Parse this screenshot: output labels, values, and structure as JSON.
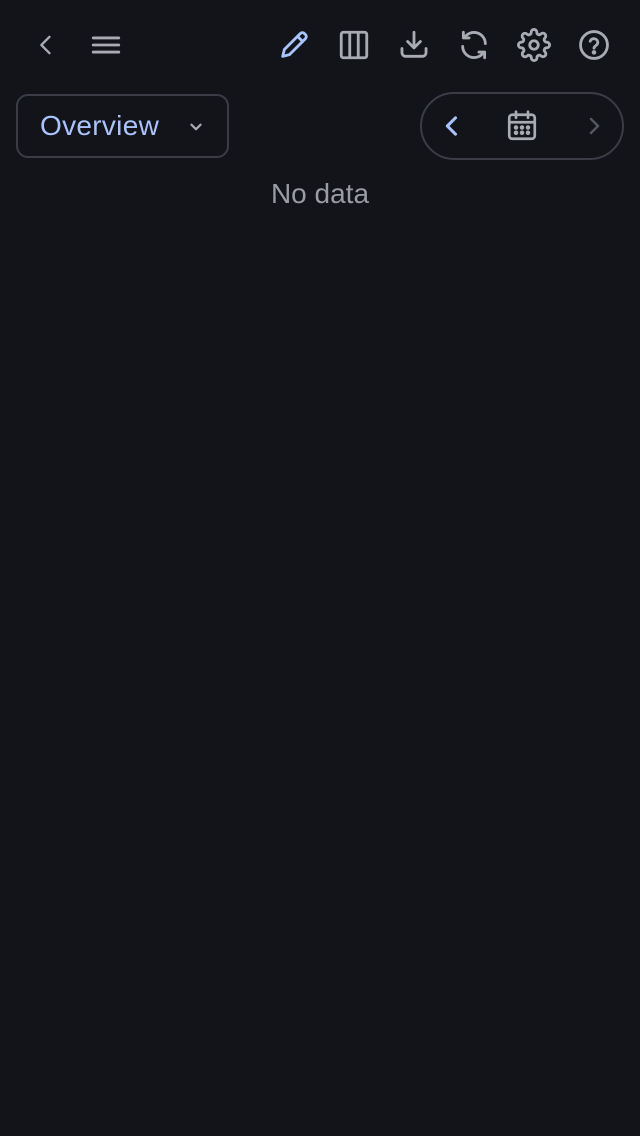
{
  "toolbar": {
    "icons": [
      "back-icon",
      "menu-icon",
      "edit-icon",
      "columns-icon",
      "download-icon",
      "refresh-icon",
      "settings-icon",
      "help-icon"
    ]
  },
  "view_selector": {
    "selected": "Overview"
  },
  "date_nav": {
    "icons": [
      "chevron-left-icon",
      "calendar-icon",
      "chevron-right-icon"
    ]
  },
  "main": {
    "empty_text": "No data"
  },
  "colors": {
    "background": "#131419",
    "icon": "#a8abb3",
    "accent": "#a9c3ff",
    "border": "#3a3d46",
    "muted_text": "#9a9ca3",
    "disabled": "#55585f"
  }
}
